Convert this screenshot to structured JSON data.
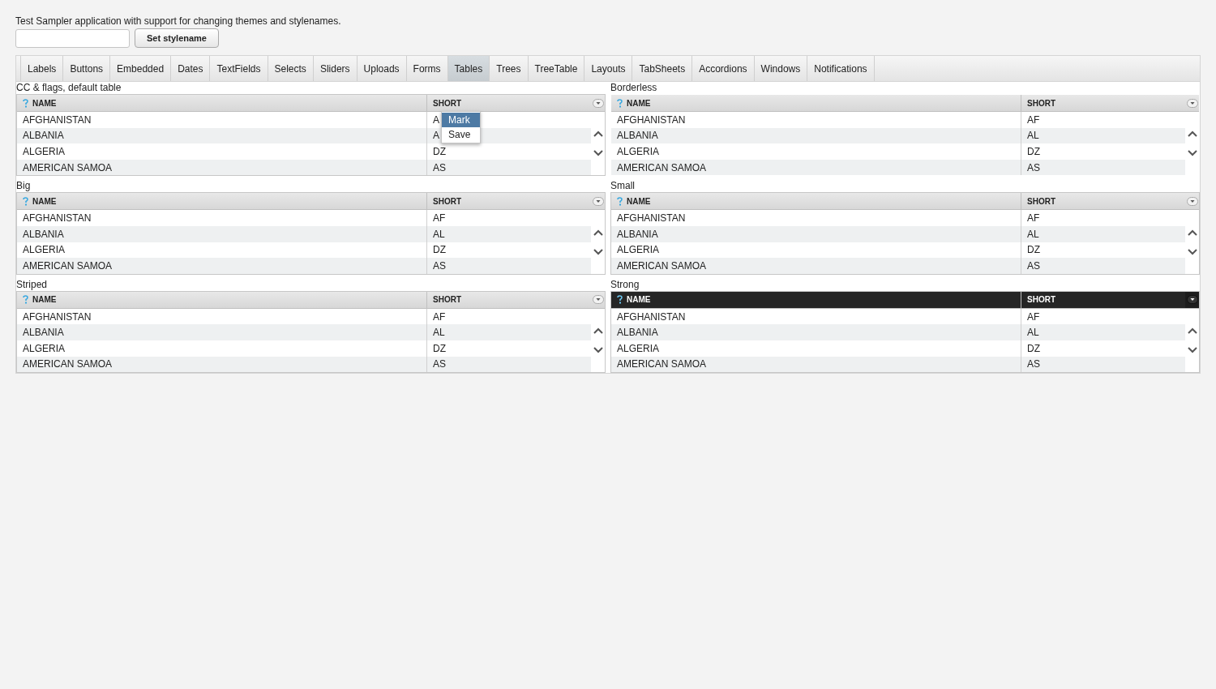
{
  "intro": "Test Sampler application with support for changing themes and stylenames.",
  "stylename_button": "Set stylename",
  "tabs": [
    {
      "label": "Labels",
      "selected": false
    },
    {
      "label": "Buttons",
      "selected": false
    },
    {
      "label": "Embedded",
      "selected": false
    },
    {
      "label": "Dates",
      "selected": false
    },
    {
      "label": "TextFields",
      "selected": false
    },
    {
      "label": "Selects",
      "selected": false
    },
    {
      "label": "Sliders",
      "selected": false
    },
    {
      "label": "Uploads",
      "selected": false
    },
    {
      "label": "Forms",
      "selected": false
    },
    {
      "label": "Tables",
      "selected": true
    },
    {
      "label": "Trees",
      "selected": false
    },
    {
      "label": "TreeTable",
      "selected": false
    },
    {
      "label": "Layouts",
      "selected": false
    },
    {
      "label": "TabSheets",
      "selected": false
    },
    {
      "label": "Accordions",
      "selected": false
    },
    {
      "label": "Windows",
      "selected": false
    },
    {
      "label": "Notifications",
      "selected": false
    }
  ],
  "tables": [
    {
      "caption": "CC & flags, default table",
      "kind": "default",
      "columns": [
        "NAME",
        "SHORT"
      ],
      "rows": [
        [
          "AFGHANISTAN",
          "A"
        ],
        [
          "ALBANIA",
          "A"
        ],
        [
          "ALGERIA",
          "DZ"
        ],
        [
          "AMERICAN SAMOA",
          "AS"
        ]
      ],
      "context_menu": [
        {
          "label": "Mark",
          "selected": true
        },
        {
          "label": "Save",
          "selected": false
        }
      ]
    },
    {
      "caption": "Borderless",
      "kind": "borderless",
      "columns": [
        "NAME",
        "SHORT"
      ],
      "rows": [
        [
          "AFGHANISTAN",
          "AF"
        ],
        [
          "ALBANIA",
          "AL"
        ],
        [
          "ALGERIA",
          "DZ"
        ],
        [
          "AMERICAN SAMOA",
          "AS"
        ]
      ]
    },
    {
      "caption": "Big",
      "kind": "default",
      "columns": [
        "NAME",
        "SHORT"
      ],
      "rows": [
        [
          "AFGHANISTAN",
          "AF"
        ],
        [
          "ALBANIA",
          "AL"
        ],
        [
          "ALGERIA",
          "DZ"
        ],
        [
          "AMERICAN SAMOA",
          "AS"
        ]
      ]
    },
    {
      "caption": "Small",
      "kind": "default",
      "columns": [
        "NAME",
        "SHORT"
      ],
      "rows": [
        [
          "AFGHANISTAN",
          "AF"
        ],
        [
          "ALBANIA",
          "AL"
        ],
        [
          "ALGERIA",
          "DZ"
        ],
        [
          "AMERICAN SAMOA",
          "AS"
        ]
      ]
    },
    {
      "caption": "Striped",
      "kind": "default",
      "columns": [
        "NAME",
        "SHORT"
      ],
      "rows": [
        [
          "AFGHANISTAN",
          "AF"
        ],
        [
          "ALBANIA",
          "AL"
        ],
        [
          "ALGERIA",
          "DZ"
        ],
        [
          "AMERICAN SAMOA",
          "AS"
        ]
      ]
    },
    {
      "caption": "Strong",
      "kind": "strong",
      "columns": [
        "NAME",
        "SHORT"
      ],
      "rows": [
        [
          "AFGHANISTAN",
          "AF"
        ],
        [
          "ALBANIA",
          "AL"
        ],
        [
          "ALGERIA",
          "DZ"
        ],
        [
          "AMERICAN SAMOA",
          "AS"
        ]
      ]
    }
  ]
}
